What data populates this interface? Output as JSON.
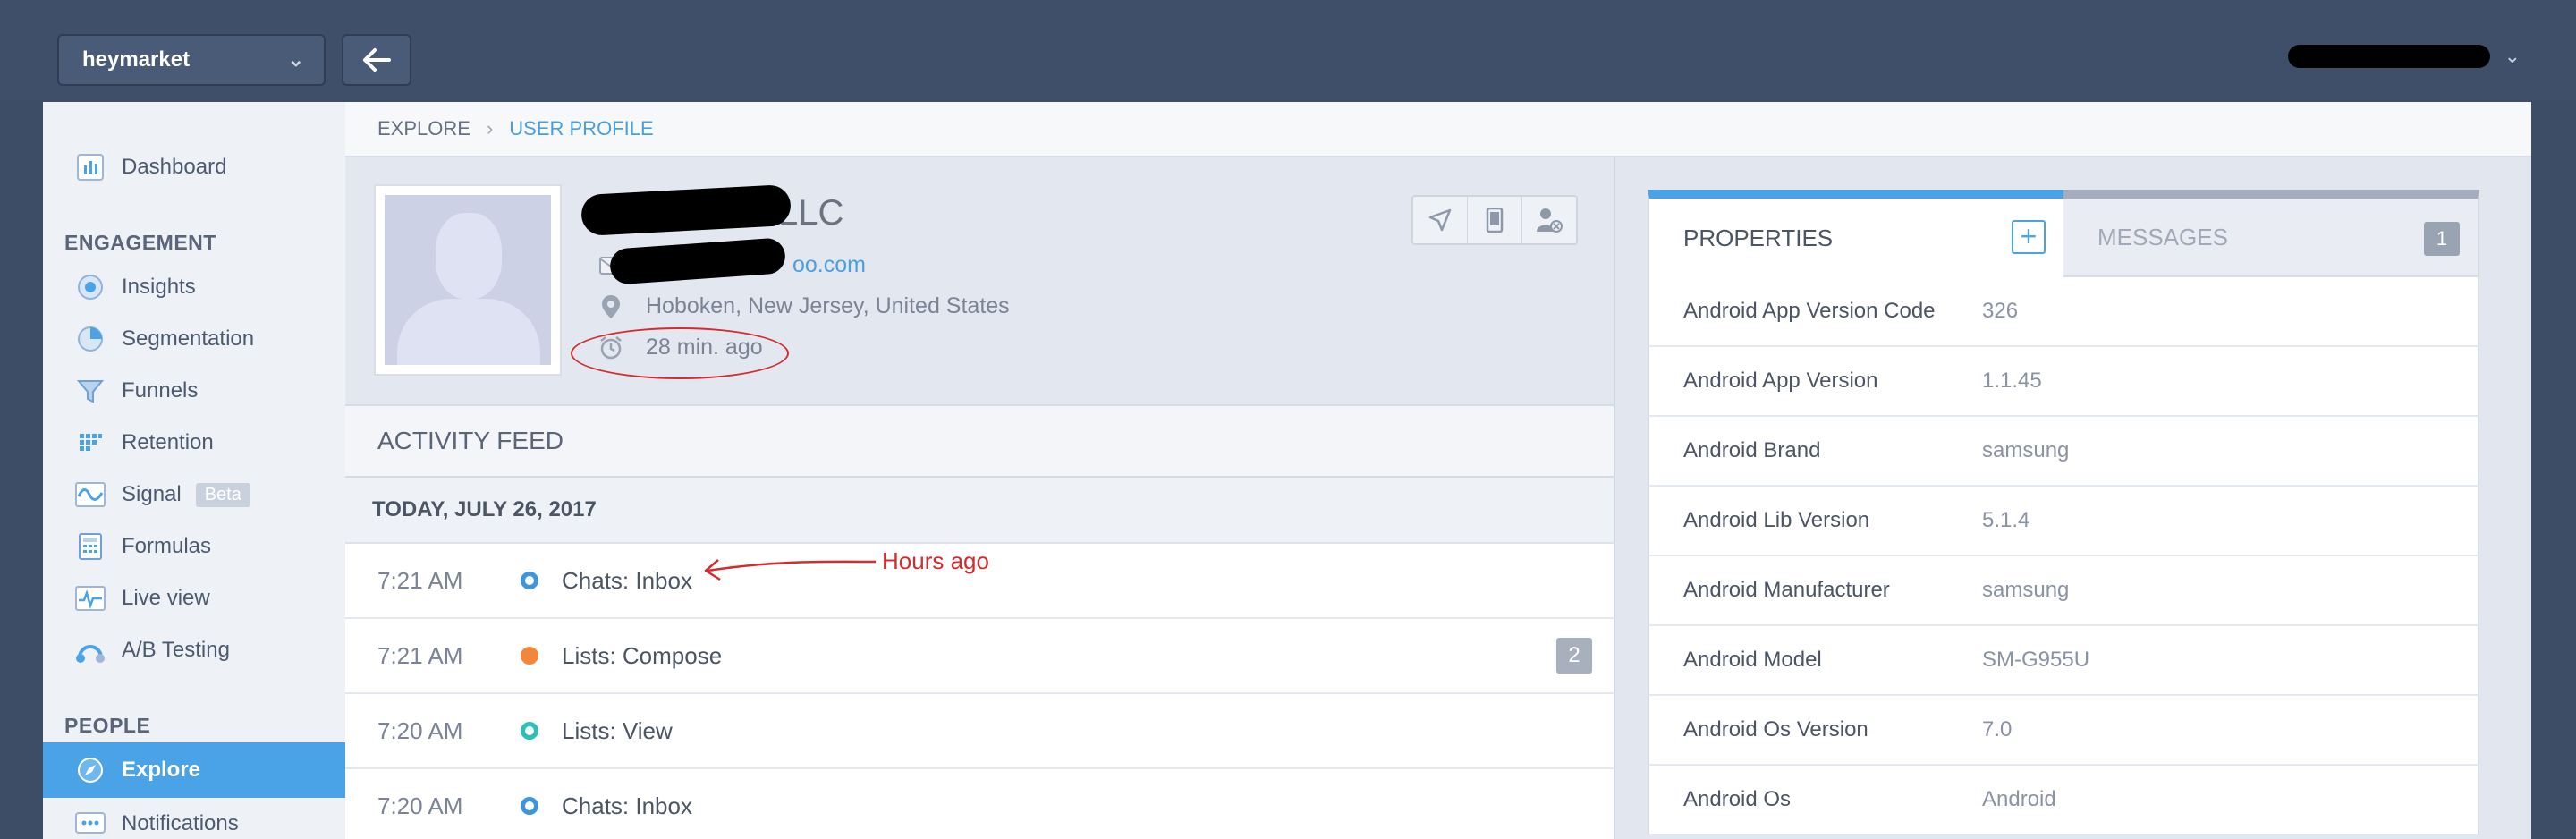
{
  "topbar": {
    "project_name": "heymarket",
    "project_chevron": "⌄",
    "user_chevron": "⌄"
  },
  "sidebar": {
    "dashboard": "Dashboard",
    "engagement_heading": "ENGAGEMENT",
    "engagement_items": [
      {
        "label": "Insights",
        "icon": "insights-icon"
      },
      {
        "label": "Segmentation",
        "icon": "segmentation-icon"
      },
      {
        "label": "Funnels",
        "icon": "funnel-icon"
      },
      {
        "label": "Retention",
        "icon": "retention-icon"
      },
      {
        "label": "Signal",
        "icon": "signal-icon",
        "badge": "Beta"
      },
      {
        "label": "Formulas",
        "icon": "formulas-icon"
      },
      {
        "label": "Live view",
        "icon": "live-view-icon"
      },
      {
        "label": "A/B Testing",
        "icon": "ab-testing-icon"
      }
    ],
    "people_heading": "PEOPLE",
    "people_items": [
      {
        "label": "Explore",
        "icon": "explore-icon",
        "active": true
      },
      {
        "label": "Notifications",
        "icon": "notifications-icon"
      }
    ]
  },
  "breadcrumb": {
    "parent": "EXPLORE",
    "current": "USER PROFILE"
  },
  "profile": {
    "name_suffix": "LLC",
    "email_suffix": "oo.com",
    "location": "Hoboken, New Jersey, United States",
    "last_seen": "28 min. ago"
  },
  "activity_feed": {
    "title": "ACTIVITY FEED",
    "date": "TODAY, JULY 26, 2017",
    "events": [
      {
        "time": "7:21 AM",
        "name": "Chats: Inbox",
        "dot": "blue"
      },
      {
        "time": "7:21 AM",
        "name": "Lists: Compose",
        "dot": "orange",
        "count": "2"
      },
      {
        "time": "7:20 AM",
        "name": "Lists: View",
        "dot": "teal"
      },
      {
        "time": "7:20 AM",
        "name": "Chats: Inbox",
        "dot": "blue"
      }
    ]
  },
  "annotation": {
    "text": "Hours ago",
    "color": "#d42c2c"
  },
  "properties_panel": {
    "tab_properties": "PROPERTIES",
    "tab_add": "+",
    "tab_messages": "MESSAGES",
    "messages_count": "1",
    "rows": [
      {
        "key": "Android App Version Code",
        "value": "326"
      },
      {
        "key": "Android App Version",
        "value": "1.1.45"
      },
      {
        "key": "Android Brand",
        "value": "samsung"
      },
      {
        "key": "Android Lib Version",
        "value": "5.1.4"
      },
      {
        "key": "Android Manufacturer",
        "value": "samsung"
      },
      {
        "key": "Android Model",
        "value": "SM-G955U"
      },
      {
        "key": "Android Os Version",
        "value": "7.0"
      },
      {
        "key": "Android Os",
        "value": "Android"
      }
    ]
  },
  "colors": {
    "accent": "#4aa3e6",
    "topbar": "#3f4f6a",
    "annotation_red": "#d42c2c"
  }
}
